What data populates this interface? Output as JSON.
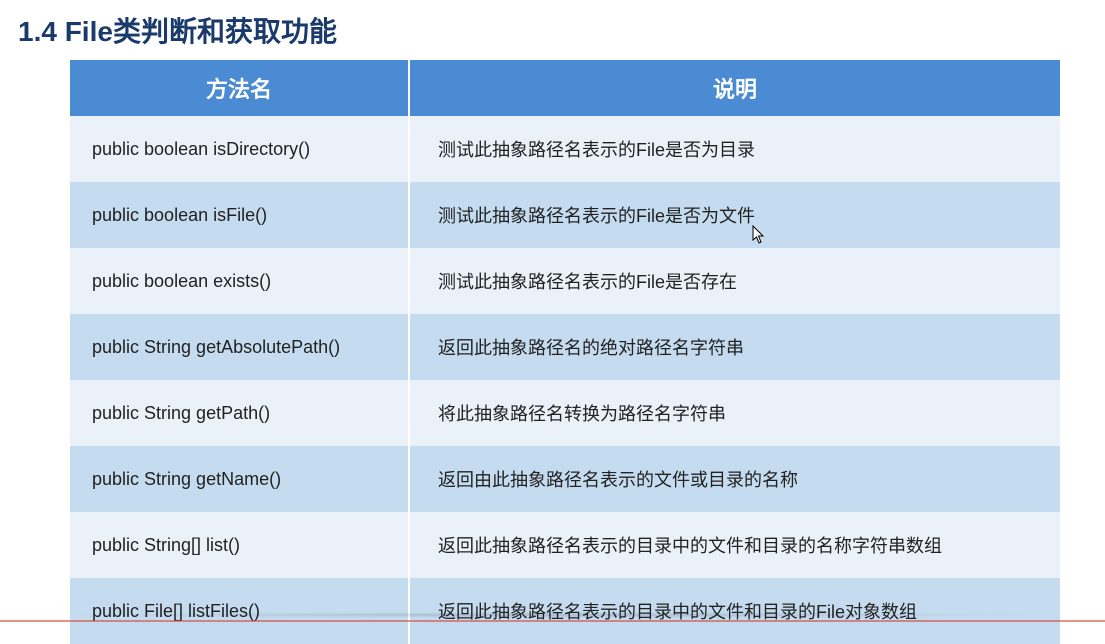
{
  "heading": "1.4 File类判断和获取功能",
  "table": {
    "headers": {
      "method": "方法名",
      "desc": "说明"
    },
    "rows": [
      {
        "method": "public boolean isDirectory()",
        "desc": "测试此抽象路径名表示的File是否为目录"
      },
      {
        "method": "public boolean isFile()",
        "desc": "测试此抽象路径名表示的File是否为文件"
      },
      {
        "method": "public boolean exists()",
        "desc": "测试此抽象路径名表示的File是否存在"
      },
      {
        "method": "public String getAbsolutePath()",
        "desc": "返回此抽象路径名的绝对路径名字符串"
      },
      {
        "method": "public String getPath()",
        "desc": "将此抽象路径名转换为路径名字符串"
      },
      {
        "method": "public String getName()",
        "desc": "返回由此抽象路径名表示的文件或目录的名称"
      },
      {
        "method": "public String[] list()",
        "desc": "返回此抽象路径名表示的目录中的文件和目录的名称字符串数组"
      },
      {
        "method": "public File[] listFiles()",
        "desc": "返回此抽象路径名表示的目录中的文件和目录的File对象数组"
      }
    ]
  }
}
